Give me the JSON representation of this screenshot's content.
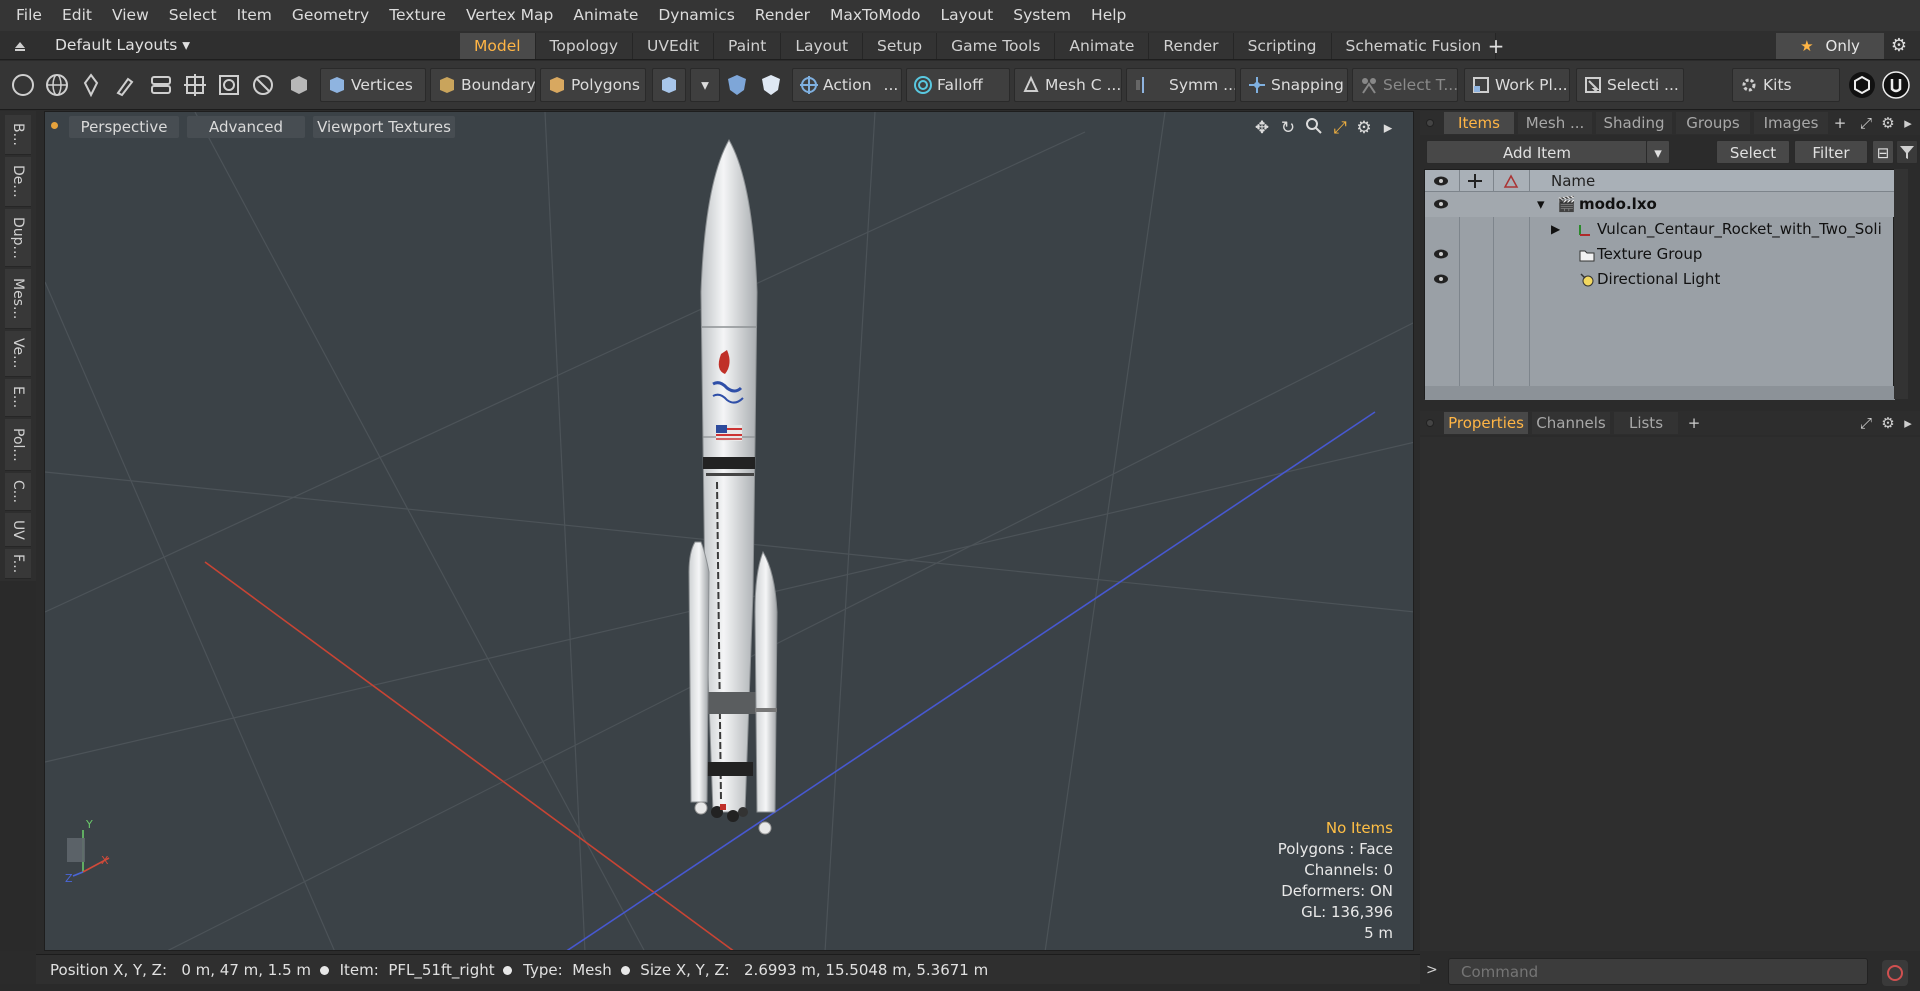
{
  "menu": [
    "File",
    "Edit",
    "View",
    "Select",
    "Item",
    "Geometry",
    "Texture",
    "Vertex Map",
    "Animate",
    "Dynamics",
    "Render",
    "MaxToModo",
    "Layout",
    "System",
    "Help"
  ],
  "layout": {
    "selector": "Default Layouts ▾",
    "tabs": [
      "Model",
      "Topology",
      "UVEdit",
      "Paint",
      "Layout",
      "Setup",
      "Game Tools",
      "Animate",
      "Render",
      "Scripting",
      "Schematic Fusion"
    ],
    "active_tab": "Model",
    "add": "+",
    "only_label": "Only"
  },
  "toolbar": {
    "vertices": "Vertices",
    "boundary": "Boundary",
    "polygons": "Polygons",
    "action": "Action",
    "action_more": "...",
    "falloff": "Falloff",
    "mesh": "Mesh C ...",
    "symmetry": "Symm ...",
    "snapping": "Snapping",
    "select_t": "Select T...",
    "work_plane": "Work Pl...",
    "selection": "Selecti ...",
    "kits": "Kits"
  },
  "left_tabs": [
    "B...",
    "De...",
    "Dup...",
    "Mes...",
    "Ve...",
    "E...",
    "Pol...",
    "C...",
    "UV",
    "F..."
  ],
  "viewport": {
    "tabs": [
      "Perspective",
      "Advanced",
      "Viewport Textures"
    ],
    "info": {
      "selection": "No Items",
      "polygons": "Polygons : Face",
      "channels": "Channels: 0",
      "deformers": "Deformers: ON",
      "gl": "GL: 136,396",
      "distance": "5 m"
    },
    "axis_labels": {
      "x": "X",
      "y": "Y",
      "z": "Z"
    }
  },
  "status": {
    "position_label": "Position X, Y, Z:",
    "position_value": "0 m, 47 m, 1.5 m",
    "item_label": "Item:",
    "item_value": "PFL_51ft_right",
    "type_label": "Type:",
    "type_value": "Mesh",
    "size_label": "Size X, Y, Z:",
    "size_value": "2.6993 m, 15.5048 m, 5.3671 m"
  },
  "items_panel": {
    "tabs": [
      "Items",
      "Mesh ...",
      "Shading",
      "Groups",
      "Images"
    ],
    "active_tab": "Items",
    "add_tab": "+",
    "add_item": "Add Item",
    "select": "Select",
    "filter": "Filter",
    "column_name": "Name",
    "rows": [
      {
        "label": "modo.lxo",
        "bold": true
      },
      {
        "label": "Vulcan_Centaur_Rocket_with_Two_Soli ..."
      },
      {
        "label": "Texture Group"
      },
      {
        "label": "Directional Light"
      }
    ]
  },
  "properties_panel": {
    "tabs": [
      "Properties",
      "Channels",
      "Lists"
    ],
    "active_tab": "Properties",
    "add_tab": "+"
  },
  "command": {
    "placeholder": "Command"
  },
  "colors": {
    "accent": "#ffb545",
    "viewport_bg": "#3b4247",
    "x_axis": "#d24a3a",
    "z_axis": "#4b5fd6"
  }
}
